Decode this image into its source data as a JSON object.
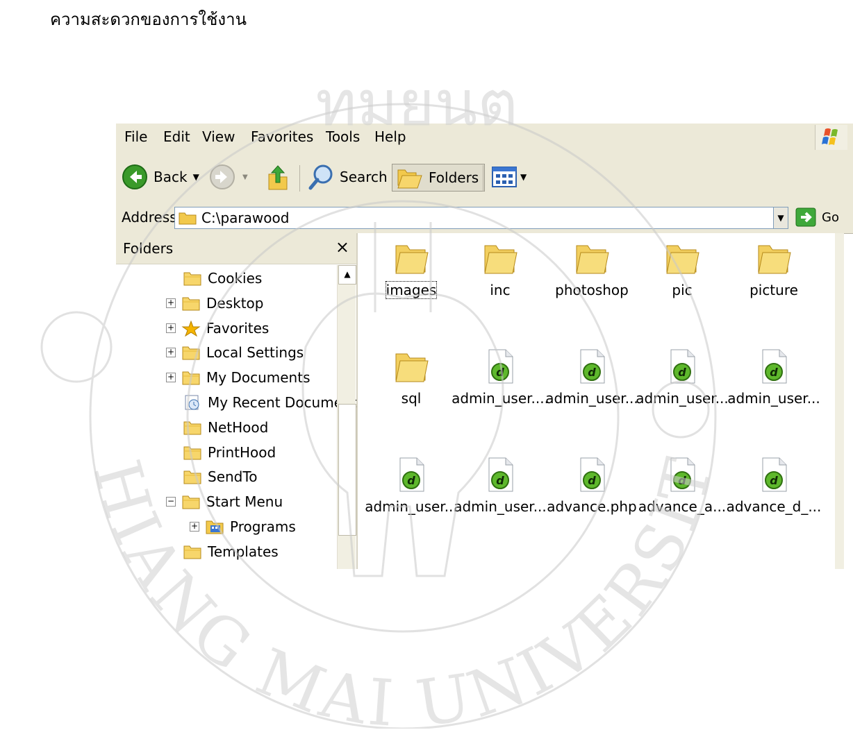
{
  "caption": "ความสะดวกของการใช้งาน",
  "menubar": {
    "items": [
      "File",
      "Edit",
      "View",
      "Favorites",
      "Tools",
      "Help"
    ]
  },
  "toolbar": {
    "back_label": "Back",
    "search_label": "Search",
    "folders_label": "Folders"
  },
  "addressbar": {
    "label": "Address",
    "value": "C:\\parawood",
    "go_label": "Go"
  },
  "folders_pane": {
    "title": "Folders",
    "close": "×",
    "items": [
      {
        "label": "Cookies",
        "expander": ""
      },
      {
        "label": "Desktop",
        "expander": "+"
      },
      {
        "label": "Favorites",
        "expander": "+"
      },
      {
        "label": "Local Settings",
        "expander": "+"
      },
      {
        "label": "My Documents",
        "expander": "+"
      },
      {
        "label": "My Recent Document",
        "expander": ""
      },
      {
        "label": "NetHood",
        "expander": ""
      },
      {
        "label": "PrintHood",
        "expander": ""
      },
      {
        "label": "SendTo",
        "expander": ""
      },
      {
        "label": "Start Menu",
        "expander": "−"
      },
      {
        "label": "Programs",
        "expander": "+"
      },
      {
        "label": "Templates",
        "expander": ""
      }
    ]
  },
  "files": [
    {
      "label": "images",
      "type": "folder"
    },
    {
      "label": "inc",
      "type": "folder"
    },
    {
      "label": "photoshop",
      "type": "folder"
    },
    {
      "label": "pic",
      "type": "folder"
    },
    {
      "label": "picture",
      "type": "folder"
    },
    {
      "label": "sql",
      "type": "folder"
    },
    {
      "label": "admin_user....",
      "type": "dw"
    },
    {
      "label": "admin_user...",
      "type": "dw"
    },
    {
      "label": "admin_user...",
      "type": "dw"
    },
    {
      "label": "admin_user...",
      "type": "dw"
    },
    {
      "label": "admin_user...",
      "type": "dw"
    },
    {
      "label": "admin_user...",
      "type": "dw"
    },
    {
      "label": "advance.php",
      "type": "dw"
    },
    {
      "label": "advance_a...",
      "type": "dw"
    },
    {
      "label": "advance_d_...",
      "type": "dw"
    }
  ],
  "watermark": {
    "top_text": "ทมยนต",
    "bottom_text": "CHIANG MAI UNIVERSITY"
  },
  "colors": {
    "xp_bar": "#ece9d8",
    "folder_yellow": "#f7d66b",
    "dw_green": "#5eb82c"
  }
}
